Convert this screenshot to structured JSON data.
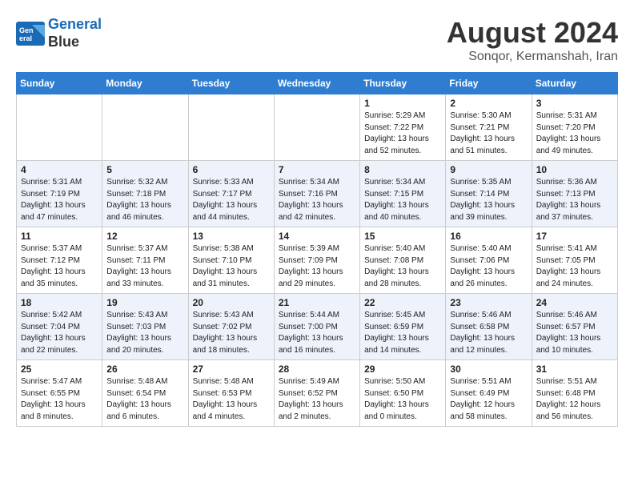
{
  "header": {
    "logo_line1": "General",
    "logo_line2": "Blue",
    "month": "August 2024",
    "location": "Sonqor, Kermanshah, Iran"
  },
  "weekdays": [
    "Sunday",
    "Monday",
    "Tuesday",
    "Wednesday",
    "Thursday",
    "Friday",
    "Saturday"
  ],
  "weeks": [
    [
      {
        "day": "",
        "info": ""
      },
      {
        "day": "",
        "info": ""
      },
      {
        "day": "",
        "info": ""
      },
      {
        "day": "",
        "info": ""
      },
      {
        "day": "1",
        "info": "Sunrise: 5:29 AM\nSunset: 7:22 PM\nDaylight: 13 hours\nand 52 minutes."
      },
      {
        "day": "2",
        "info": "Sunrise: 5:30 AM\nSunset: 7:21 PM\nDaylight: 13 hours\nand 51 minutes."
      },
      {
        "day": "3",
        "info": "Sunrise: 5:31 AM\nSunset: 7:20 PM\nDaylight: 13 hours\nand 49 minutes."
      }
    ],
    [
      {
        "day": "4",
        "info": "Sunrise: 5:31 AM\nSunset: 7:19 PM\nDaylight: 13 hours\nand 47 minutes."
      },
      {
        "day": "5",
        "info": "Sunrise: 5:32 AM\nSunset: 7:18 PM\nDaylight: 13 hours\nand 46 minutes."
      },
      {
        "day": "6",
        "info": "Sunrise: 5:33 AM\nSunset: 7:17 PM\nDaylight: 13 hours\nand 44 minutes."
      },
      {
        "day": "7",
        "info": "Sunrise: 5:34 AM\nSunset: 7:16 PM\nDaylight: 13 hours\nand 42 minutes."
      },
      {
        "day": "8",
        "info": "Sunrise: 5:34 AM\nSunset: 7:15 PM\nDaylight: 13 hours\nand 40 minutes."
      },
      {
        "day": "9",
        "info": "Sunrise: 5:35 AM\nSunset: 7:14 PM\nDaylight: 13 hours\nand 39 minutes."
      },
      {
        "day": "10",
        "info": "Sunrise: 5:36 AM\nSunset: 7:13 PM\nDaylight: 13 hours\nand 37 minutes."
      }
    ],
    [
      {
        "day": "11",
        "info": "Sunrise: 5:37 AM\nSunset: 7:12 PM\nDaylight: 13 hours\nand 35 minutes."
      },
      {
        "day": "12",
        "info": "Sunrise: 5:37 AM\nSunset: 7:11 PM\nDaylight: 13 hours\nand 33 minutes."
      },
      {
        "day": "13",
        "info": "Sunrise: 5:38 AM\nSunset: 7:10 PM\nDaylight: 13 hours\nand 31 minutes."
      },
      {
        "day": "14",
        "info": "Sunrise: 5:39 AM\nSunset: 7:09 PM\nDaylight: 13 hours\nand 29 minutes."
      },
      {
        "day": "15",
        "info": "Sunrise: 5:40 AM\nSunset: 7:08 PM\nDaylight: 13 hours\nand 28 minutes."
      },
      {
        "day": "16",
        "info": "Sunrise: 5:40 AM\nSunset: 7:06 PM\nDaylight: 13 hours\nand 26 minutes."
      },
      {
        "day": "17",
        "info": "Sunrise: 5:41 AM\nSunset: 7:05 PM\nDaylight: 13 hours\nand 24 minutes."
      }
    ],
    [
      {
        "day": "18",
        "info": "Sunrise: 5:42 AM\nSunset: 7:04 PM\nDaylight: 13 hours\nand 22 minutes."
      },
      {
        "day": "19",
        "info": "Sunrise: 5:43 AM\nSunset: 7:03 PM\nDaylight: 13 hours\nand 20 minutes."
      },
      {
        "day": "20",
        "info": "Sunrise: 5:43 AM\nSunset: 7:02 PM\nDaylight: 13 hours\nand 18 minutes."
      },
      {
        "day": "21",
        "info": "Sunrise: 5:44 AM\nSunset: 7:00 PM\nDaylight: 13 hours\nand 16 minutes."
      },
      {
        "day": "22",
        "info": "Sunrise: 5:45 AM\nSunset: 6:59 PM\nDaylight: 13 hours\nand 14 minutes."
      },
      {
        "day": "23",
        "info": "Sunrise: 5:46 AM\nSunset: 6:58 PM\nDaylight: 13 hours\nand 12 minutes."
      },
      {
        "day": "24",
        "info": "Sunrise: 5:46 AM\nSunset: 6:57 PM\nDaylight: 13 hours\nand 10 minutes."
      }
    ],
    [
      {
        "day": "25",
        "info": "Sunrise: 5:47 AM\nSunset: 6:55 PM\nDaylight: 13 hours\nand 8 minutes."
      },
      {
        "day": "26",
        "info": "Sunrise: 5:48 AM\nSunset: 6:54 PM\nDaylight: 13 hours\nand 6 minutes."
      },
      {
        "day": "27",
        "info": "Sunrise: 5:48 AM\nSunset: 6:53 PM\nDaylight: 13 hours\nand 4 minutes."
      },
      {
        "day": "28",
        "info": "Sunrise: 5:49 AM\nSunset: 6:52 PM\nDaylight: 13 hours\nand 2 minutes."
      },
      {
        "day": "29",
        "info": "Sunrise: 5:50 AM\nSunset: 6:50 PM\nDaylight: 13 hours\nand 0 minutes."
      },
      {
        "day": "30",
        "info": "Sunrise: 5:51 AM\nSunset: 6:49 PM\nDaylight: 12 hours\nand 58 minutes."
      },
      {
        "day": "31",
        "info": "Sunrise: 5:51 AM\nSunset: 6:48 PM\nDaylight: 12 hours\nand 56 minutes."
      }
    ]
  ]
}
